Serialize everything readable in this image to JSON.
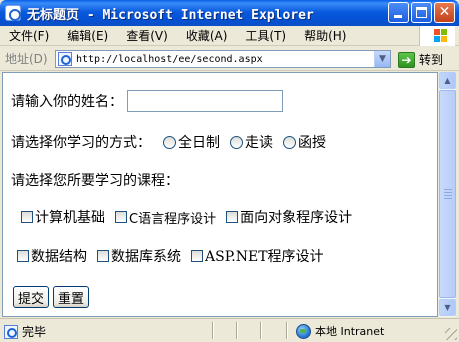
{
  "window": {
    "title": "无标题页 - Microsoft Internet Explorer"
  },
  "menu": {
    "items": [
      "文件(F)",
      "编辑(E)",
      "查看(V)",
      "收藏(A)",
      "工具(T)",
      "帮助(H)"
    ]
  },
  "address": {
    "label": "地址(D)",
    "url": "http://localhost/ee/second.aspx",
    "go_label": "转到"
  },
  "form": {
    "name_label": "请输入你的姓名：",
    "name_value": "",
    "mode_label": "请选择你学习的方式：",
    "modes": [
      "全日制",
      "走读",
      "函授"
    ],
    "course_label": "请选择您所要学习的课程：",
    "courses_row1": [
      "计算机基础",
      "C语言程序设计",
      "面向对象程序设计"
    ],
    "courses_row2": [
      "数据结构",
      "数据库系统",
      "ASP.NET程序设计"
    ],
    "submit_label": "提交",
    "reset_label": "重置"
  },
  "status": {
    "text": "完毕",
    "zone": "本地 Intranet"
  },
  "colors": {
    "titlebar": "#0A5FE6",
    "menubar": "#ECE9D8",
    "content_bg": "#FFFFFF"
  },
  "icons": {
    "app": "ie-icon",
    "page": "page-icon",
    "go": "go-arrow-icon",
    "zone": "globe-icon"
  }
}
